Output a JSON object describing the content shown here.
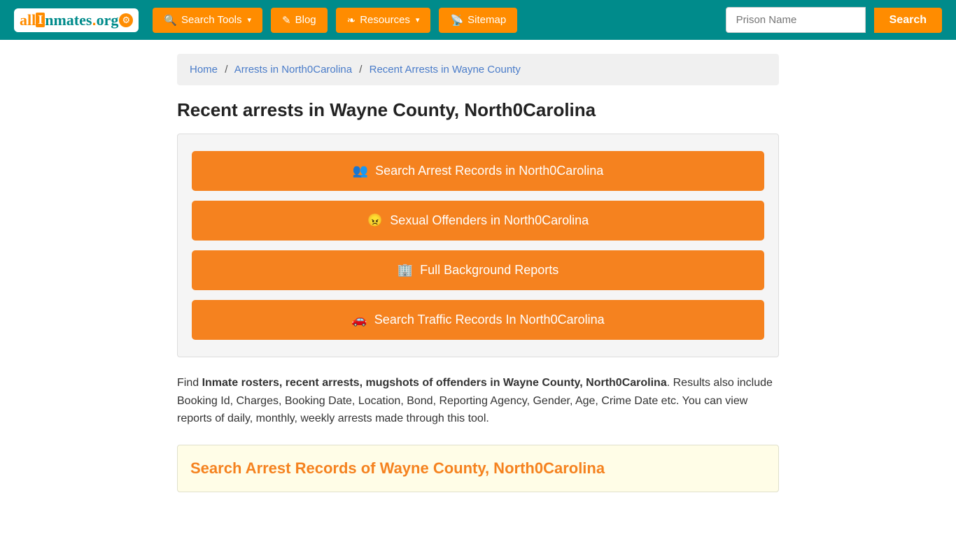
{
  "header": {
    "logo_all": "all",
    "logo_i": "I",
    "logo_nmates": "nmates",
    "logo_dot": ".",
    "logo_org": "org",
    "nav": [
      {
        "label": "Search Tools",
        "has_arrow": true,
        "icon": "🔍"
      },
      {
        "label": "Blog",
        "has_arrow": false,
        "icon": "✎"
      },
      {
        "label": "Resources",
        "has_arrow": true,
        "icon": "❧"
      },
      {
        "label": "Sitemap",
        "has_arrow": false,
        "icon": "📡"
      }
    ],
    "prison_input_placeholder": "Prison Name",
    "search_btn_label": "Search"
  },
  "breadcrumb": {
    "home": "Home",
    "arrests": "Arrests in North0Carolina",
    "current": "Recent Arrests in Wayne County"
  },
  "page_title": "Recent arrests in Wayne County, North0Carolina",
  "buttons": [
    {
      "label": "Search Arrest Records in North0Carolina",
      "icon": "👥"
    },
    {
      "label": "Sexual Offenders in North0Carolina",
      "icon": "😠"
    },
    {
      "label": "Full Background Reports",
      "icon": "🏢"
    },
    {
      "label": "Search Traffic Records In North0Carolina",
      "icon": "🚗"
    }
  ],
  "description_prefix": "Find ",
  "description_bold": "Inmate rosters, recent arrests, mugshots of offenders in Wayne County, North0Carolina",
  "description_suffix": ". Results also include Booking Id, Charges, Booking Date, Location, Bond, Reporting Agency, Gender, Age, Crime Date etc. You can view reports of daily, monthly, weekly arrests made through this tool.",
  "bottom_search_title": "Search Arrest Records of Wayne County, North0Carolina"
}
